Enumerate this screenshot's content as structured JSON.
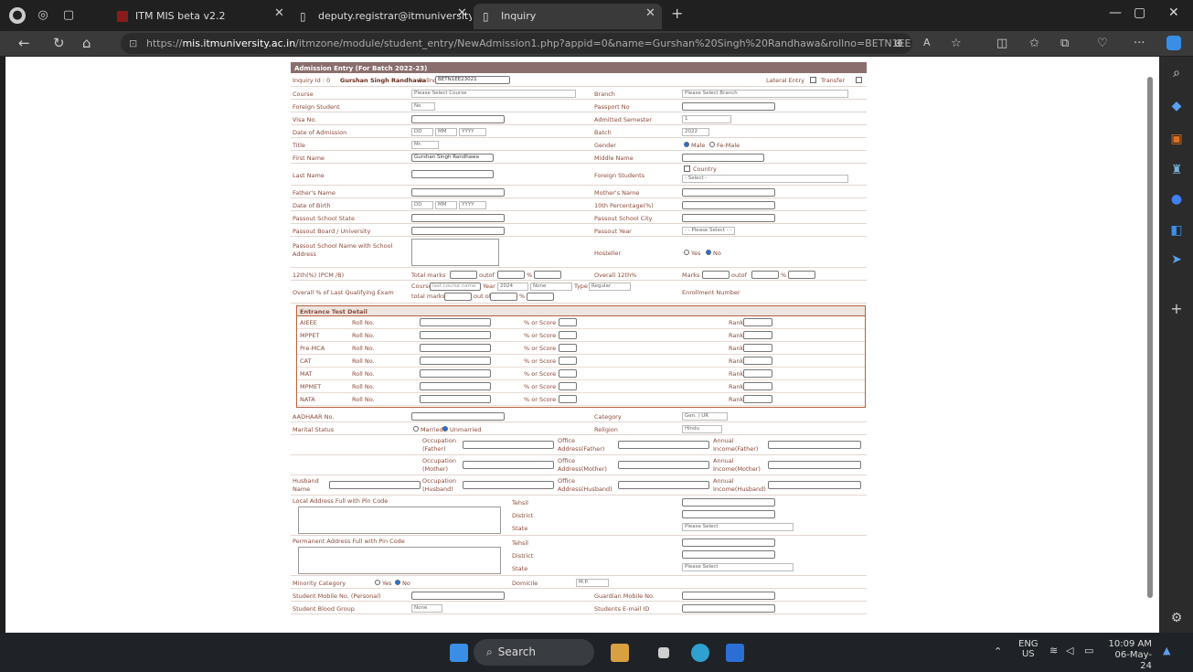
{
  "browser": {
    "tabs": [
      {
        "title": "ITM MIS beta v2.2"
      },
      {
        "title": "deputy.registrar@itmuniversity.a"
      },
      {
        "title": "Inquiry"
      }
    ],
    "url_prefix": "https://",
    "url_host": "mis.itmuniversity.ac.in",
    "url_path": "/itmzone/module/student_entry/NewAdmission1.php?appid=0&name=Gurshan%20Singh%20Randhawa&rollno=BETN1EE..."
  },
  "form": {
    "header": "Admission Entry (For Batch 2022-23)",
    "inquiry_label": "Inquiry Id : 0",
    "student_name": "Gurshan Singh Randhawa",
    "rollno_label": "Rollno",
    "rollno_value": "BETN1EE23021",
    "lateral_entry": "Lateral Entry",
    "transfer": "Transfer",
    "course_label": "Course",
    "course_value": "Please Select Course",
    "branch_label": "Branch",
    "branch_value": "Please Select Branch",
    "foreign_student_label": "Foreign Student",
    "foreign_student_value": "No",
    "passport_label": "Passport No",
    "visa_label": "Visa No.",
    "admitted_sem_label": "Admitted Semester",
    "admitted_sem_value": "1",
    "doa_label": "Date of Admission",
    "dd": "DD",
    "mm": "MM",
    "yyyy": "YYYY",
    "batch_label": "Batch",
    "batch_value": "2022",
    "title_label": "Title",
    "title_value": "Mr.",
    "gender_label": "Gender",
    "male": "Male",
    "female": "Fe-Male",
    "first_name_label": "First Name",
    "first_name_value": "Gurshan Singh Randhawa",
    "middle_name_label": "Middle Name",
    "last_name_label": "Last Name",
    "foreign_students_label": "Foreign Students",
    "country_label": "Country",
    "country_value": "- Select -",
    "father_label": "Father's Name",
    "mother_label": "Mother's Name",
    "dob_label": "Date of Birth",
    "tenth_label": "10th Percentage(%)",
    "school_state_label": "Passout School State",
    "school_city_label": "Passout School City",
    "board_label": "Passout Board / University",
    "passout_year_label": "Passout Year",
    "passout_year_value": "- - Please Select - -",
    "school_addr_label": "Passout School Name with School Address",
    "hosteller_label": "Hosteller",
    "yes": "Yes",
    "no": "No",
    "twelfth_label": "12th(%) (PCM /B)",
    "total_marks": "Total marks",
    "outof": "outof",
    "pct": "%",
    "overall12_label": "Overall 12th%",
    "marks": "Marks",
    "olq_label": "Overall % of Last Qualifying Exam",
    "olq_course": "Course",
    "olq_course_ph": "last course name",
    "olq_year": "Year",
    "olq_year_value": "2024",
    "olq_none": "None",
    "olq_type": "Type",
    "olq_type_value": "Regular",
    "olq_total": "total marks",
    "olq_outof": "out of",
    "enrollment_label": "Enrollment Number",
    "entrance_header": "Entrance Test Detail",
    "roll_no": "Roll No.",
    "score": "% or Score",
    "rank": "Rank",
    "entrance": [
      "AIEEE",
      "MPPET",
      "Pre-MCA",
      "CAT",
      "MAT",
      "MPMET",
      "NATA"
    ],
    "aadhaar_label": "AADHAAR No.",
    "category_label": "Category",
    "category_value": "Gen. / UR",
    "marital_label": "Marital Status",
    "married": "Married",
    "unmarried": "Unmarried",
    "religion_label": "Religion",
    "religion_value": "Hindu",
    "occ_father": "Occupation (Father)",
    "off_father": "Office Address(Father)",
    "inc_father": "Annual Income(Father)",
    "occ_mother": "Occupation (Mother)",
    "off_mother": "Office Address(Mother)",
    "inc_mother": "Annual Income(Mother)",
    "husband_label": "Husband Name",
    "occ_husband": "Occupation (Husband)",
    "off_husband": "Office Address(Husband)",
    "inc_husband": "Annual Income(Husband)",
    "local_addr": "Local Address Full with Pin Code",
    "tehsil": "Tehsil",
    "district": "District",
    "state": "State",
    "state_value": "Please Select",
    "perm_addr": "Permanent Address Full with Pin Code",
    "minority_label": "Minority Category",
    "domicile_label": "Domicile",
    "domicile_value": "M.P.",
    "mobile_label": "Student Mobile No. (Personal)",
    "guardian_mobile_label": "Guardian Mobile No.",
    "blood_label": "Student Blood Group",
    "blood_value": "None",
    "email_label": "Students E-mail ID"
  },
  "taskbar": {
    "search": "Search",
    "lang": "ENG",
    "region": "US",
    "time": "10:09 AM",
    "date": "06-May-24"
  }
}
